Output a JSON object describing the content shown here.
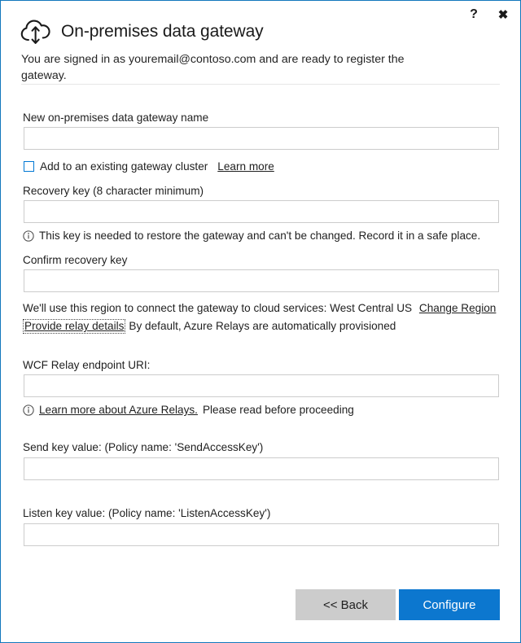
{
  "window": {
    "accent_color": "#1277bc",
    "border_color": "#1277bc"
  },
  "titlebar": {
    "help_label": "?",
    "help_icon": "question-mark-icon",
    "close_label": "✖",
    "close_icon": "close-icon"
  },
  "header": {
    "icon": "cloud-with-up-down-arrow-icon",
    "title": "On-premises data gateway",
    "status_text": "You are signed in as youremail@contoso.com and are ready to register the gateway."
  },
  "form": {
    "gateway_name": {
      "label": "New on-premises data gateway name",
      "value": "",
      "placeholder": ""
    },
    "cluster": {
      "checkbox_label": "Add to an existing gateway cluster",
      "checked": false,
      "learn_more_label": "Learn more"
    },
    "recovery_key": {
      "label": "Recovery key (8 character minimum)",
      "value": "",
      "placeholder": "",
      "hint_icon": "info-icon",
      "hint": "This key is needed to restore the gateway and can't be changed. Record it in a safe place."
    },
    "confirm_recovery_key": {
      "label": "Confirm recovery key",
      "value": "",
      "placeholder": ""
    },
    "region": {
      "text": "We'll use this region to connect the gateway to cloud services: West Central US",
      "value": "West Central US",
      "change_link_label": "Change Region"
    },
    "relay": {
      "link_label": "Provide relay details",
      "description": "By default, Azure Relays are automatically provisioned"
    },
    "wcf_relay_uri": {
      "label": "WCF Relay endpoint URI:",
      "value": "",
      "placeholder": "",
      "hint_icon": "info-icon",
      "hint_link_label": "Learn more about Azure Relays.",
      "hint_rest": "Please read before proceeding"
    },
    "send_key": {
      "label": "Send key value: (Policy name: 'SendAccessKey')",
      "value": "",
      "placeholder": ""
    },
    "listen_key": {
      "label": "Listen key value: (Policy name: 'ListenAccessKey')",
      "value": "",
      "placeholder": ""
    }
  },
  "footer": {
    "back_label": "<< Back",
    "configure_label": "Configure",
    "configure_color": "#0c77cf",
    "back_color": "#cccccc"
  }
}
